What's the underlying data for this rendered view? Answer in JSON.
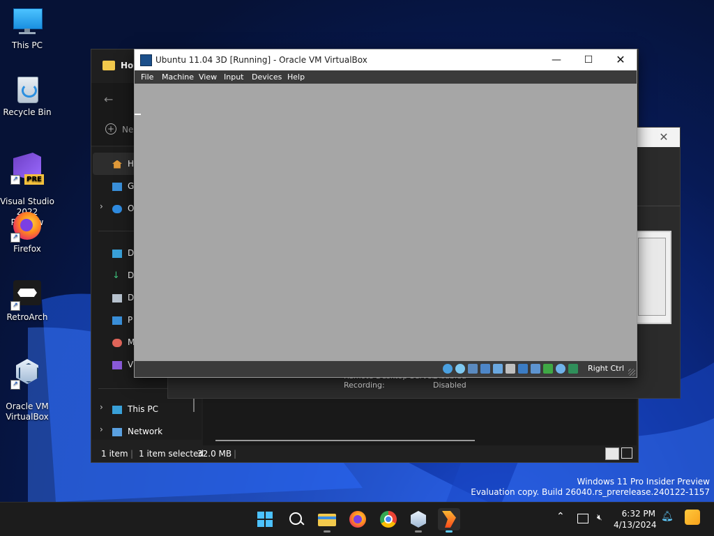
{
  "desktop": {
    "icons": [
      {
        "label": "This PC"
      },
      {
        "label": "Recycle Bin"
      },
      {
        "label": "Visual Studio\n2022 Preview",
        "badge": "PRE"
      },
      {
        "label": "Firefox"
      },
      {
        "label": "RetroArch"
      },
      {
        "label": "Oracle VM\nVirtualBox"
      }
    ]
  },
  "explorer": {
    "title_fragment": "Hos",
    "new_fragment": "Ne",
    "sidebar": [
      "H",
      "G",
      "O",
      "D",
      "D",
      "D",
      "P",
      "M",
      "V"
    ],
    "this_pc": "This PC",
    "network": "Network",
    "status": {
      "items": "1 item",
      "selected": "1 item selected",
      "size": "32.0 MB"
    },
    "details": {
      "remote_desktop_label": "Remote Desktop Server:",
      "remote_desktop_value": "Disabled",
      "recording_label": "Recording:",
      "recording_value": "Disabled"
    }
  },
  "vbox": {
    "title": "Ubuntu 11.04 3D [Running] - Oracle VM VirtualBox",
    "menu": [
      "File",
      "Machine",
      "View",
      "Input",
      "Devices",
      "Help"
    ],
    "host_key": "Right Ctrl",
    "screen_color": "#a6a6a6"
  },
  "watermark": {
    "line1": "Windows 11 Pro Insider Preview",
    "line2": "Evaluation copy. Build 26040.rs_prerelease.240122-1157"
  },
  "taskbar": {
    "apps": [
      "start-icon",
      "search-icon",
      "file-explorer-icon",
      "firefox-icon",
      "chrome-icon",
      "virtualbox-icon",
      "virtualbox-vm-icon"
    ],
    "time": "6:32 PM",
    "date": "4/13/2024"
  }
}
